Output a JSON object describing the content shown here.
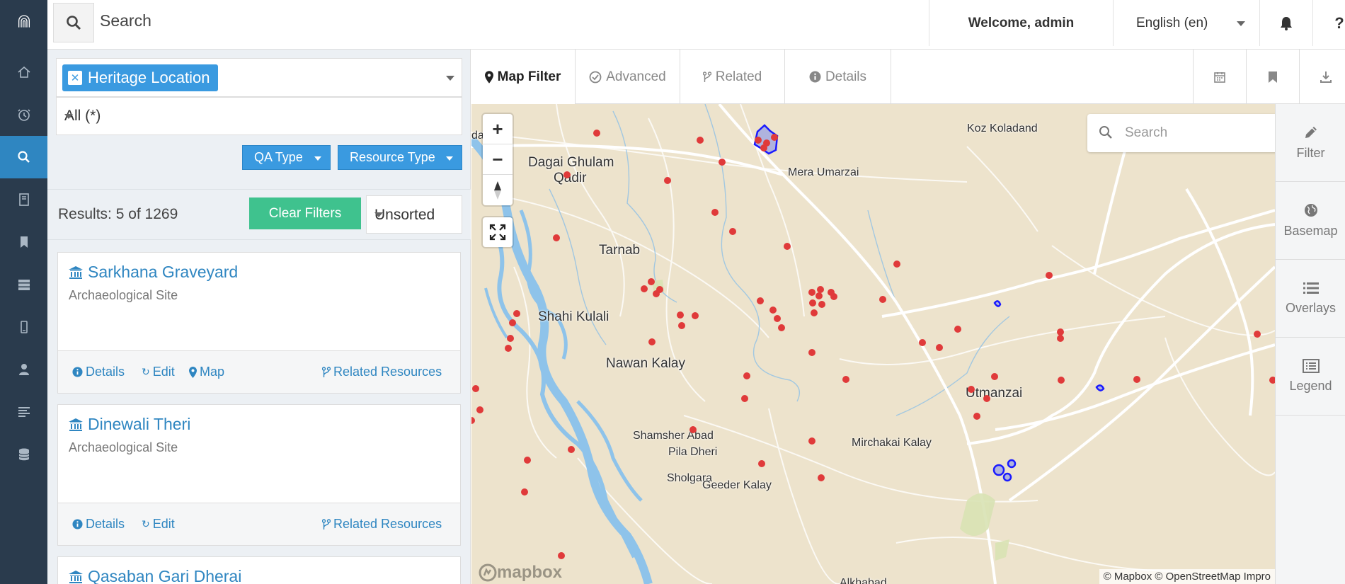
{
  "app": {
    "logo_icon": "arches-logo-icon"
  },
  "rail": {
    "items": [
      "home-icon",
      "clock-icon",
      "search-icon",
      "book-icon",
      "bookmark-icon",
      "server-icon",
      "mobile-icon",
      "user-icon",
      "list-icon",
      "database-icon"
    ],
    "active": "search-icon"
  },
  "topbar": {
    "search_label": "Search",
    "welcome": "Welcome, admin",
    "language": "English (en)"
  },
  "panel": {
    "resource_tag": "Heritage Location",
    "filter_select": "All (*)",
    "qa_type_label": "QA Type",
    "resource_type_label": "Resource Type",
    "results_text": "Results: 5 of 1269",
    "clear_filters_label": "Clear Filters",
    "sort_value": "Unsorted"
  },
  "results": [
    {
      "title": "Sarkhana Graveyard",
      "subtitle": "Archaeological Site",
      "details": "Details",
      "edit": "Edit",
      "map": "Map",
      "related": "Related Resources"
    },
    {
      "title": "Dinewali Theri",
      "subtitle": "Archaeological Site",
      "details": "Details",
      "edit": "Edit",
      "related": "Related Resources"
    },
    {
      "title": "Qasaban Gari Dherai"
    }
  ],
  "tabs": {
    "map_filter": "Map Filter",
    "advanced": "Advanced",
    "related": "Related",
    "details": "Details"
  },
  "map": {
    "search_placeholder": "Search",
    "attribution": "© Mapbox © OpenStreetMap Impro",
    "mapbox_logo": "mapbox",
    "places": {
      "koz_koladand": "Koz Koladand",
      "dagai_ghulam_qadir_1": "Dagai Ghulam",
      "dagai_ghulam_qadir_2": "Qadir",
      "mera_umarzai": "Mera Umarzai",
      "tarnab": "Tarnab",
      "shahi_kulali": "Shahi Kulali",
      "nawan_kalay": "Nawan Kalay",
      "utmanzai": "Utmanzai",
      "shamsher_abad": "Shamsher Abad",
      "pila_dheri": "Pila Dheri",
      "mirchakai_kalay": "Mirchakai Kalay",
      "sholgara": "Sholgara",
      "geeder_kalay": "Geeder Kalay",
      "partial_top": "da...hi",
      "partial_bottom": "Alkhabad"
    },
    "site_marker_color": "#e03a3a",
    "polygon_color": "#1a1aff"
  },
  "side_panel": {
    "filter": "Filter",
    "basemap": "Basemap",
    "overlays": "Overlays",
    "legend": "Legend"
  }
}
